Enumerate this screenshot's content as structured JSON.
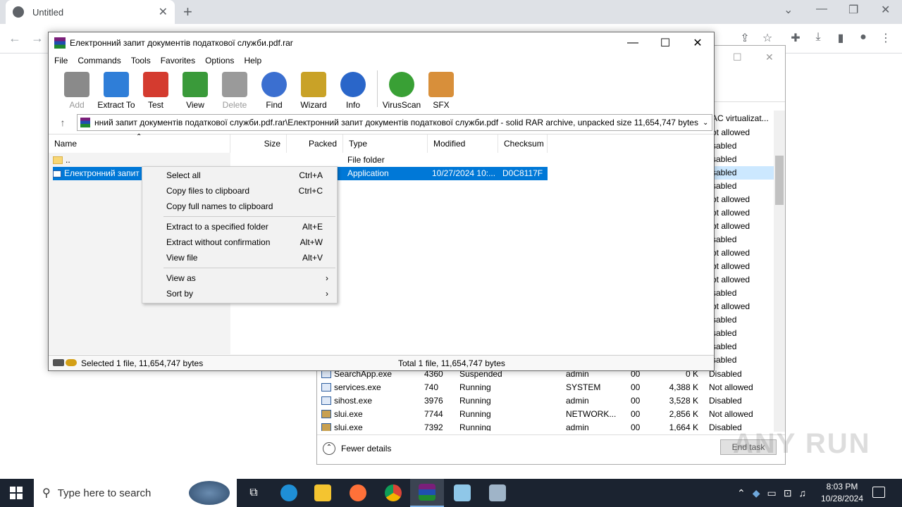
{
  "chrome": {
    "tab_title": "Untitled",
    "new_tab": "+",
    "tab_close": "✕"
  },
  "winrar": {
    "title": "Електронний запит документів податкової служби.pdf.rar",
    "menu": [
      "File",
      "Commands",
      "Tools",
      "Favorites",
      "Options",
      "Help"
    ],
    "toolbar": [
      {
        "label": "Add",
        "icon": "add-archive-icon",
        "disabled": true,
        "color": "#8a8a8a"
      },
      {
        "label": "Extract To",
        "icon": "extract-folder-icon",
        "disabled": false,
        "color": "#2f7ed8"
      },
      {
        "label": "Test",
        "icon": "test-clipboard-icon",
        "disabled": false,
        "color": "#d43b2f"
      },
      {
        "label": "View",
        "icon": "view-book-icon",
        "disabled": false,
        "color": "#3a9a3a"
      },
      {
        "label": "Delete",
        "icon": "delete-bin-icon",
        "disabled": true,
        "color": "#9a9a9a"
      },
      {
        "label": "Find",
        "icon": "find-magnifier-icon",
        "disabled": false,
        "color": "#3b6fd0"
      },
      {
        "label": "Wizard",
        "icon": "wizard-wand-icon",
        "disabled": false,
        "color": "#c9a227"
      },
      {
        "label": "Info",
        "icon": "info-icon",
        "disabled": false,
        "color": "#2a66c9"
      },
      {
        "label": "VirusScan",
        "icon": "virusscan-bug-icon",
        "disabled": false,
        "color": "#39a035"
      },
      {
        "label": "SFX",
        "icon": "sfx-box-icon",
        "disabled": false,
        "color": "#d88f3a"
      }
    ],
    "address": "нний запит документів податкової служби.pdf.rar\\Електронний запит документів податкової служби.pdf - solid RAR archive, unpacked size 11,654,747 bytes",
    "columns": {
      "name": "Name",
      "size": "Size",
      "packed": "Packed",
      "type": "Type",
      "modified": "Modified",
      "checksum": "Checksum"
    },
    "rows": [
      {
        "name": "..",
        "type": "File folder",
        "modified": "",
        "checksum": ""
      },
      {
        "name": "Електронний запит",
        "type": "Application",
        "modified": "10/27/2024 10:...",
        "checksum": "D0C8117F"
      }
    ],
    "status_left": "Selected 1 file, 11,654,747 bytes",
    "status_right": "Total 1 file, 11,654,747 bytes"
  },
  "context_menu": {
    "items": [
      {
        "label": "Select all",
        "shortcut": "Ctrl+A"
      },
      {
        "label": "Copy files to clipboard",
        "shortcut": "Ctrl+C"
      },
      {
        "label": "Copy full names to clipboard",
        "shortcut": ""
      },
      {
        "label": "Extract to a specified folder",
        "shortcut": "Alt+E"
      },
      {
        "label": "Extract without confirmation",
        "shortcut": "Alt+W"
      },
      {
        "label": "View file",
        "shortcut": "Alt+V"
      },
      {
        "label": "View as",
        "shortcut": ""
      },
      {
        "label": "Sort by",
        "shortcut": ""
      }
    ]
  },
  "taskmgr": {
    "status_header": "AC virtualizat...",
    "status_col": [
      "ot allowed",
      "sabled",
      "sabled",
      "sabled",
      "sabled",
      "ot allowed",
      "ot allowed",
      "ot allowed",
      "sabled",
      "ot allowed",
      "ot allowed",
      "ot allowed",
      "sabled",
      "ot allowed",
      "sabled",
      "sabled",
      "sabled",
      "sabled"
    ],
    "processes": [
      {
        "name": "SearchApp.exe",
        "pid": "4360",
        "status": "Suspended",
        "user": "admin",
        "cpu": "00",
        "mem": "0 K",
        "uac": "Disabled"
      },
      {
        "name": "services.exe",
        "pid": "740",
        "status": "Running",
        "user": "SYSTEM",
        "cpu": "00",
        "mem": "4,388 K",
        "uac": "Not allowed"
      },
      {
        "name": "sihost.exe",
        "pid": "3976",
        "status": "Running",
        "user": "admin",
        "cpu": "00",
        "mem": "3,528 K",
        "uac": "Disabled"
      },
      {
        "name": "slui.exe",
        "pid": "7744",
        "status": "Running",
        "user": "NETWORK...",
        "cpu": "00",
        "mem": "2,856 K",
        "uac": "Not allowed"
      },
      {
        "name": "slui.exe",
        "pid": "7392",
        "status": "Running",
        "user": "admin",
        "cpu": "00",
        "mem": "1,664 K",
        "uac": "Disabled"
      }
    ],
    "fewer_details": "Fewer details",
    "end_task": "End task"
  },
  "taskbar": {
    "search_placeholder": "Type here to search",
    "time": "8:03 PM",
    "date": "10/28/2024"
  },
  "watermark": "ANY RUN"
}
